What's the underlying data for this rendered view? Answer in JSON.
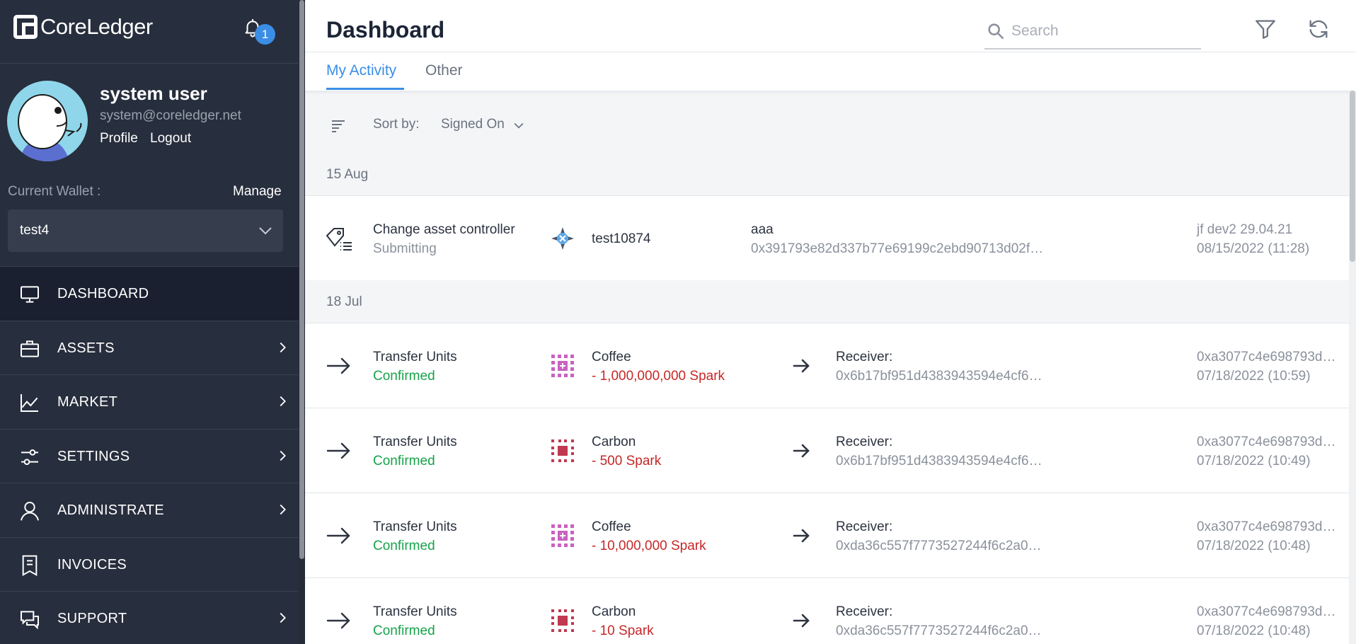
{
  "app": {
    "brand": "CoreLedger",
    "notification_count": "1"
  },
  "user": {
    "name": "system user",
    "email": "system@coreledger.net",
    "profile_label": "Profile",
    "logout_label": "Logout"
  },
  "wallet": {
    "label": "Current Wallet :",
    "manage_label": "Manage",
    "selected": "test4"
  },
  "nav": [
    {
      "label": "DASHBOARD",
      "icon": "monitor-icon",
      "active": true,
      "expandable": false
    },
    {
      "label": "ASSETS",
      "icon": "briefcase-icon",
      "active": false,
      "expandable": true
    },
    {
      "label": "MARKET",
      "icon": "chart-line-icon",
      "active": false,
      "expandable": true
    },
    {
      "label": "SETTINGS",
      "icon": "sliders-icon",
      "active": false,
      "expandable": true
    },
    {
      "label": "ADMINISTRATE",
      "icon": "user-icon",
      "active": false,
      "expandable": true
    },
    {
      "label": "INVOICES",
      "icon": "receipt-icon",
      "active": false,
      "expandable": false
    },
    {
      "label": "SUPPORT",
      "icon": "chat-support-icon",
      "active": false,
      "expandable": true
    }
  ],
  "header": {
    "title": "Dashboard",
    "search_placeholder": "Search"
  },
  "tabs": [
    {
      "label": "My Activity",
      "active": true
    },
    {
      "label": "Other",
      "active": false
    }
  ],
  "sort": {
    "label": "Sort by:",
    "value": "Signed On"
  },
  "groups": [
    {
      "date": "15 Aug",
      "items": [
        {
          "title": "Change asset controller",
          "status": "Submitting",
          "asset": "test10874",
          "mid_top": "aaa",
          "mid_bottom": "0x391793e82d337b77e69199c2ebd90713d02f…",
          "right_top": "jf dev2 29.04.21",
          "right_bottom": "08/15/2022 (11:28)"
        }
      ]
    },
    {
      "date": "18 Jul",
      "items": [
        {
          "title": "Transfer Units",
          "status": "Confirmed",
          "asset": "Coffee",
          "amount": "- 1,000,000,000 Spark",
          "receiver_label": "Receiver:",
          "receiver": "0x6b17bf951d4383943594e4cf6…",
          "right_top": "0xa3077c4e698793d…",
          "right_bottom": "07/18/2022 (10:59)"
        },
        {
          "title": "Transfer Units",
          "status": "Confirmed",
          "asset": "Carbon",
          "amount": "- 500 Spark",
          "receiver_label": "Receiver:",
          "receiver": "0x6b17bf951d4383943594e4cf6…",
          "right_top": "0xa3077c4e698793d…",
          "right_bottom": "07/18/2022 (10:49)"
        },
        {
          "title": "Transfer Units",
          "status": "Confirmed",
          "asset": "Coffee",
          "amount": "- 10,000,000 Spark",
          "receiver_label": "Receiver:",
          "receiver": "0xda36c557f7773527244f6c2a0…",
          "right_top": "0xa3077c4e698793d…",
          "right_bottom": "07/18/2022 (10:48)"
        },
        {
          "title": "Transfer Units",
          "status": "Confirmed",
          "asset": "Carbon",
          "amount": "- 10 Spark",
          "receiver_label": "Receiver:",
          "receiver": "0xda36c557f7773527244f6c2a0…",
          "right_top": "0xa3077c4e698793d…",
          "right_bottom": "07/18/2022 (10:48)"
        }
      ]
    }
  ],
  "colors": {
    "sidebar": "#272e3d",
    "accent": "#3b8ee6",
    "confirmed": "#16a34a",
    "amount": "#c62828"
  }
}
